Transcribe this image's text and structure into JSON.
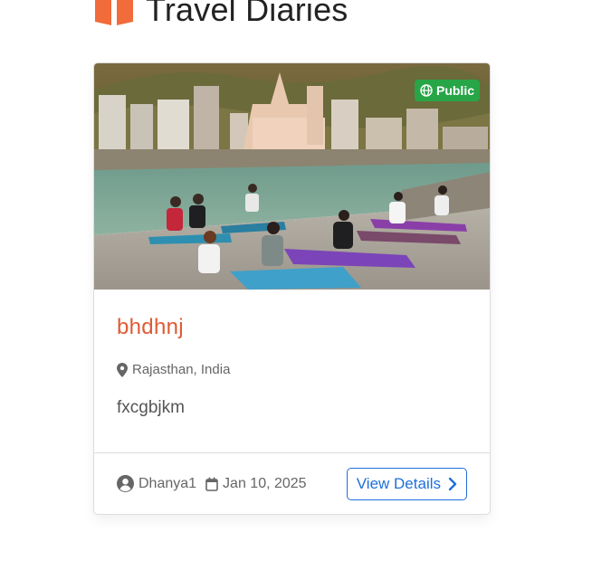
{
  "page": {
    "title": "Travel Diaries",
    "accent_color": "#f26b3a"
  },
  "card": {
    "badge": {
      "label": "Public",
      "icon": "globe-icon",
      "color": "#27a547"
    },
    "title": "bhdhnj",
    "location": {
      "icon": "map-marker-icon",
      "text": "Rajasthan, India"
    },
    "description": "fxcgbjkm",
    "author": {
      "icon": "user-circle-icon",
      "name": "Dhanya1"
    },
    "date": {
      "icon": "calendar-icon",
      "text": "Jan 10, 2025"
    },
    "button": {
      "label": "View Details",
      "icon": "chevron-right-icon",
      "color": "#1e6fd9"
    }
  }
}
